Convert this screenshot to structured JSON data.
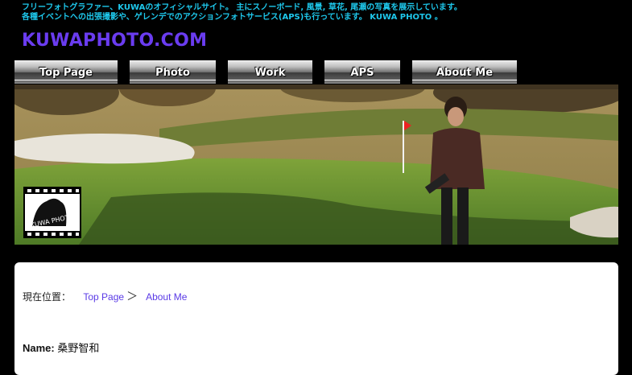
{
  "header": {
    "tagline_line1": "フリーフォトグラファー、KUWAのオフィシャルサイト。 主にスノーボード, 風景, 草花, 尾瀬の写真を展示しています。",
    "tagline_line2": "各種イベントへの出張撮影や、ゲレンデでのアクションフォトサービス(APS)も行っています。 KUWA PHOTO 。",
    "site_title": "KUWAPHOTO.COM"
  },
  "nav": {
    "items": [
      {
        "label": "Top Page"
      },
      {
        "label": "Photo"
      },
      {
        "label": "Work"
      },
      {
        "label": "APS"
      },
      {
        "label": "About Me"
      }
    ]
  },
  "banner": {
    "logo_text": "KUWA PHOTO"
  },
  "breadcrumb": {
    "prefix": "現在位置：",
    "top_link": "Top Page",
    "separator": "＞",
    "current": "About Me"
  },
  "profile": {
    "name_label": "Name:",
    "name_value": "桑野智和"
  },
  "colors": {
    "background": "#000000",
    "tagline": "#1ec8ec",
    "title": "#6a3cf0",
    "link": "#5a3ae6"
  }
}
